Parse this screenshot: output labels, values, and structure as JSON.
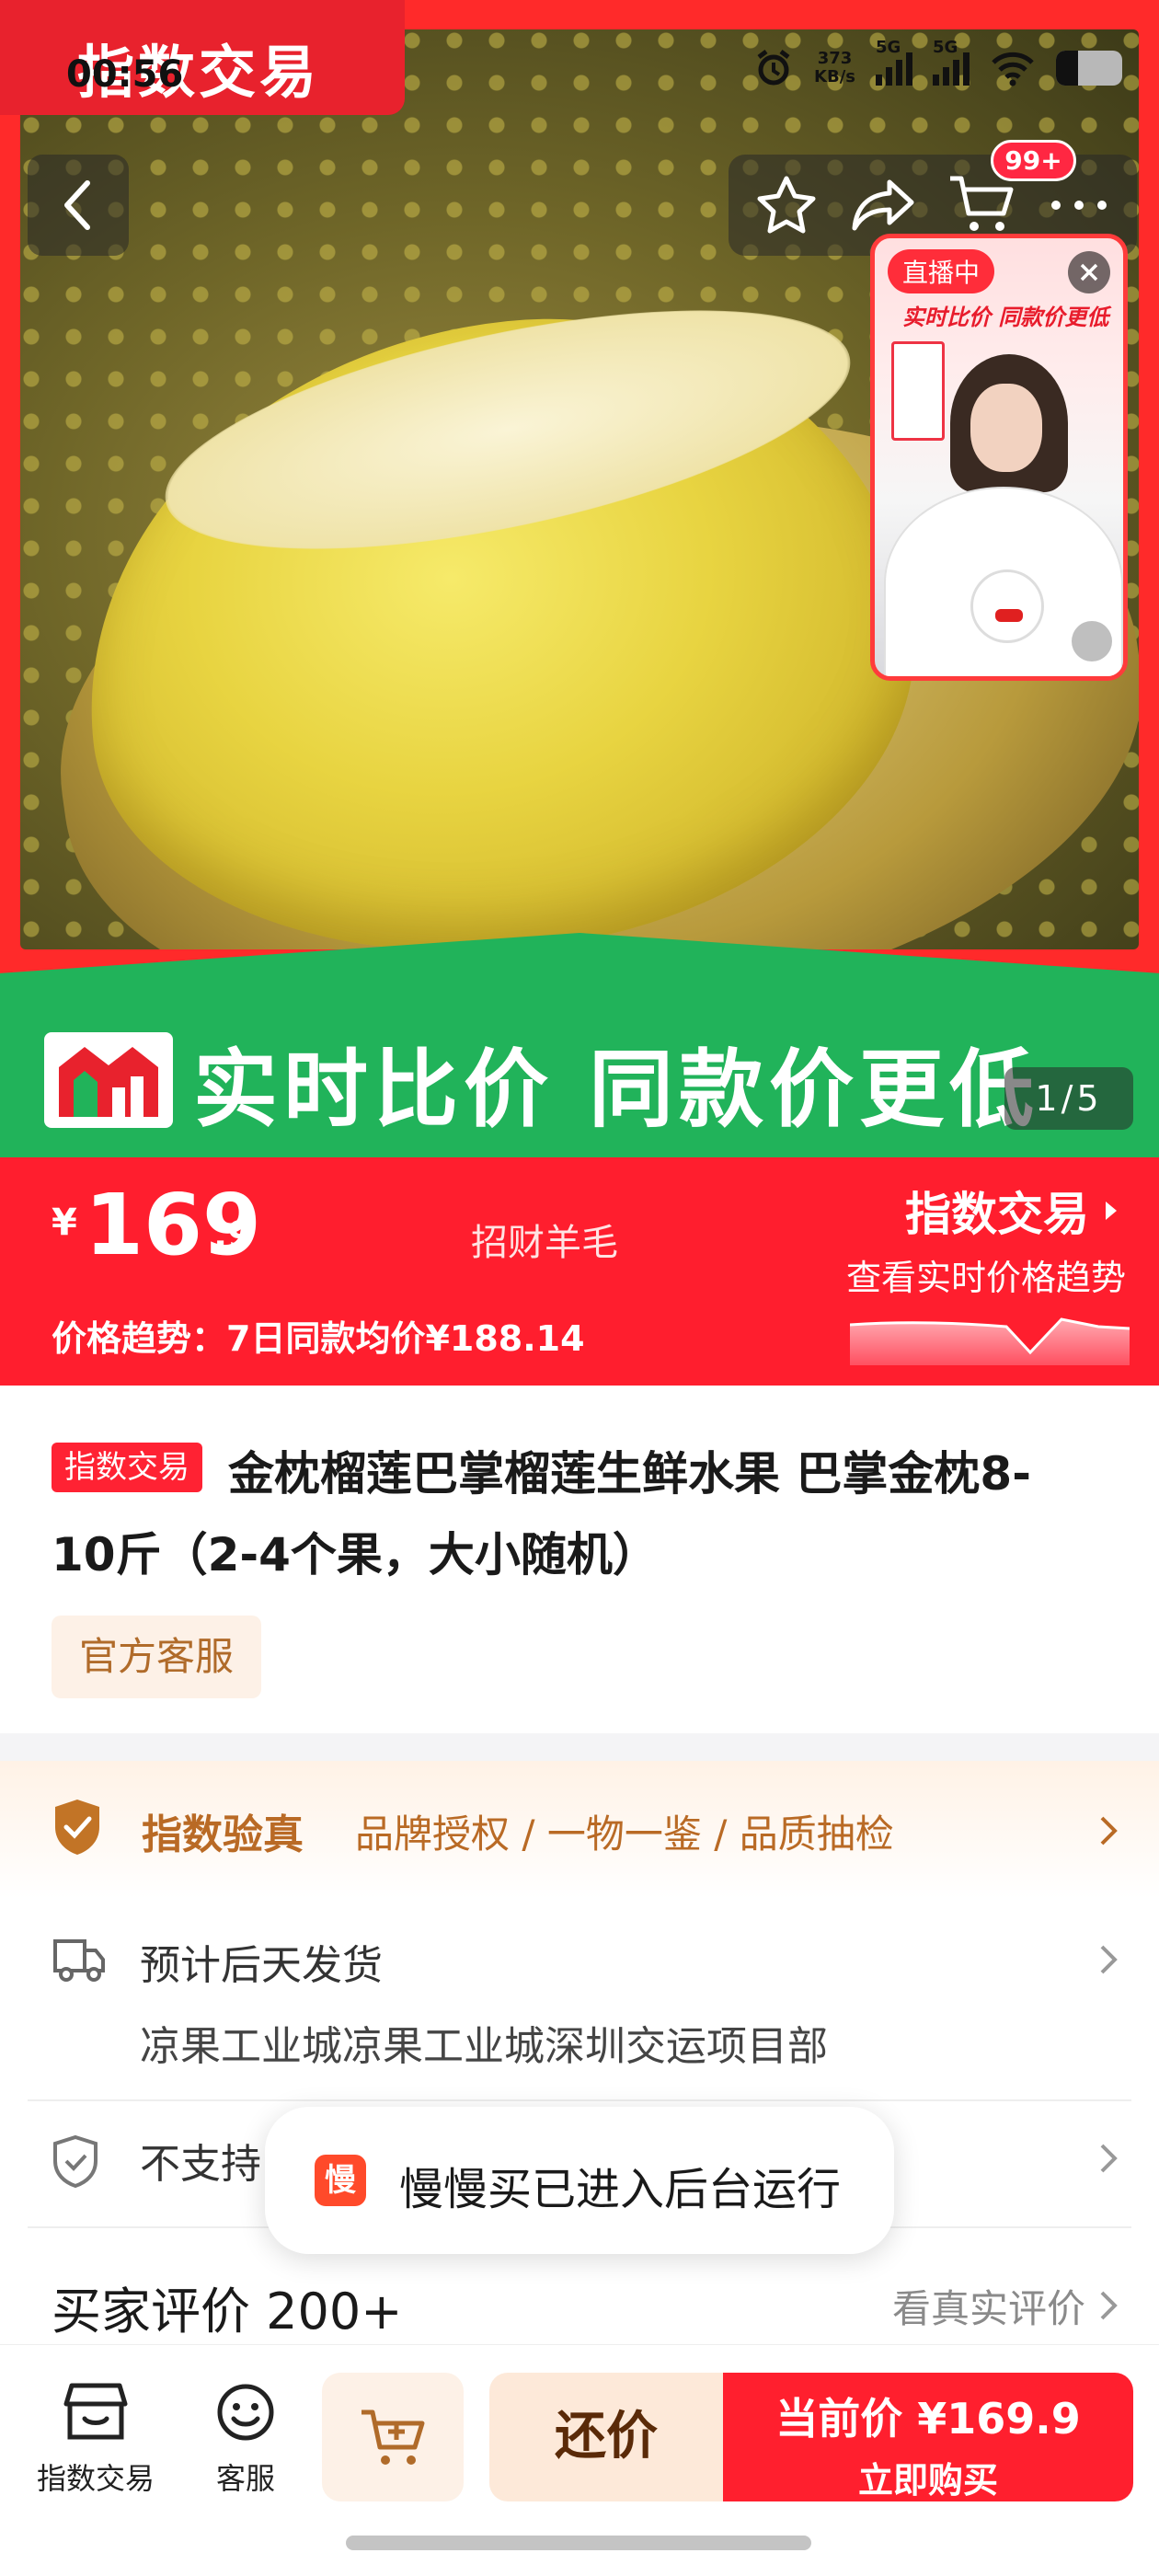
{
  "status_bar": {
    "time": "00:56",
    "net_speed": "373",
    "net_unit": "KB/s",
    "sig1": "5G",
    "sig2": "5G"
  },
  "hero": {
    "app_tag": "指数交易",
    "cart_badge": "99+",
    "live_badge": "直播中",
    "live_slogan": "实时比价 同款价更低",
    "banner_text": "实时比价 同款价更低",
    "pager": "1/5"
  },
  "price": {
    "yen": "¥",
    "integer": "169",
    "decimal": ".9",
    "promo": "招财羊毛",
    "brand": "指数交易",
    "trend_link": "查看实时价格趋势",
    "trend_text": "价格趋势：7日同款均价¥188.14"
  },
  "product": {
    "tag": "指数交易",
    "title_line1": "金枕榴莲巴掌榴莲生鲜水果 巴掌金枕8-",
    "title_line2": "10斤（2-4个果，大小随机）",
    "service_tag": "官方客服"
  },
  "info": {
    "verify_title": "指数验真",
    "verify_desc": "品牌授权 / 一物一鉴 / 品质抽检",
    "ship_title": "预计后天发货",
    "ship_address": "凉果工业城凉果工业城深圳交运项目部",
    "return_text": "不支持",
    "review_title": "买家评价 200+",
    "review_link": "看真实评价"
  },
  "toast": {
    "logo": "慢",
    "text": "慢慢买已进入后台运行"
  },
  "bottom": {
    "nav1": "指数交易",
    "nav2": "客服",
    "bargain": "还价",
    "buy_price": "当前价 ¥169.9",
    "buy_label": "立即购买"
  }
}
